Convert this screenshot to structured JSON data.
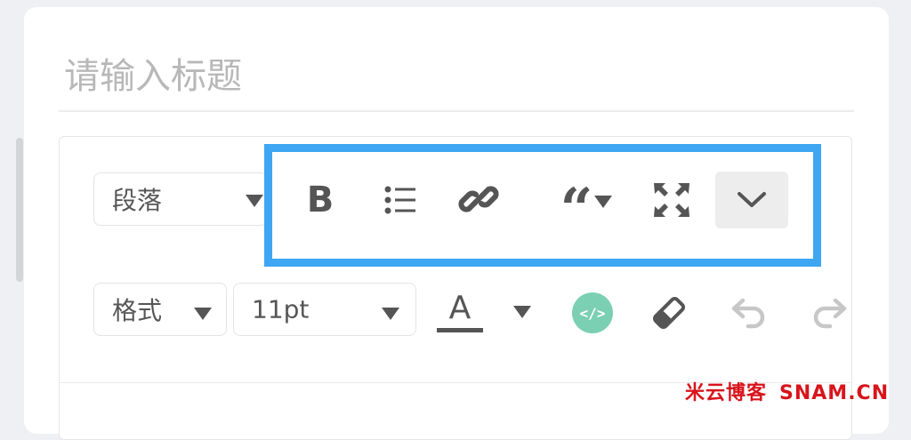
{
  "title_input": {
    "placeholder": "请输入标题"
  },
  "toolbar_row1": {
    "block_select": {
      "value": "段落"
    },
    "buttons": [
      {
        "name": "bold-button",
        "icon": "bold-icon",
        "glyph": "B"
      },
      {
        "name": "bullet-list-button",
        "icon": "bullet-list-icon"
      },
      {
        "name": "link-button",
        "icon": "link-icon"
      },
      {
        "name": "blockquote-button",
        "icon": "quote-icon",
        "glyph": "“"
      },
      {
        "name": "fullscreen-button",
        "icon": "fullscreen-icon"
      },
      {
        "name": "more-button",
        "icon": "chevron-down-icon"
      }
    ]
  },
  "toolbar_row2": {
    "format_select": {
      "value": "格式"
    },
    "fontsize_select": {
      "value": "11pt"
    },
    "text_color_button": {
      "glyph": "A",
      "underline_color": "#555555"
    },
    "source_code_button": {
      "icon": "code-icon",
      "color": "#7bcfb3",
      "glyph": "</>"
    },
    "clear_format_button": {
      "icon": "eraser-icon"
    },
    "undo_button": {
      "icon": "undo-icon"
    },
    "redo_button": {
      "icon": "redo-icon"
    }
  },
  "highlight_color": "#3ea6f2",
  "watermark": {
    "brand": "米云博客",
    "site": "SNAM.CN",
    "color": "#d8141c"
  }
}
